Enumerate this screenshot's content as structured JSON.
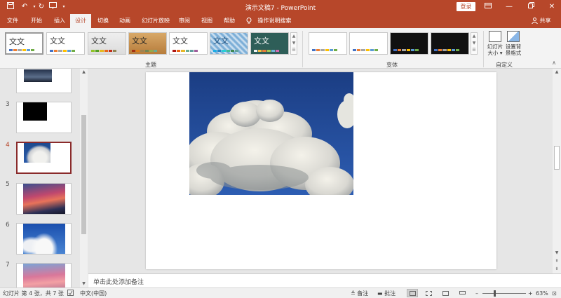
{
  "app": {
    "title": "演示文稿7  -  PowerPoint",
    "login_label": "登录",
    "quick_access": [
      "save-icon",
      "undo-icon",
      "redo-icon",
      "start-presentation-icon"
    ],
    "window_controls": [
      "ribbon-display-options-icon",
      "minimize-icon",
      "maximize-icon",
      "close-icon"
    ]
  },
  "ribbon": {
    "tabs": [
      {
        "label": "文件"
      },
      {
        "label": "开始"
      },
      {
        "label": "插入"
      },
      {
        "label": "设计"
      },
      {
        "label": "切换"
      },
      {
        "label": "动画"
      },
      {
        "label": "幻灯片放映"
      },
      {
        "label": "审阅"
      },
      {
        "label": "视图"
      },
      {
        "label": "帮助"
      }
    ],
    "active_tab": "设计",
    "tell_me": "操作说明搜索",
    "share_label": "共享",
    "themes_group": {
      "label": "主题",
      "items": [
        {
          "text": "文文",
          "style": "office"
        },
        {
          "text": "文文",
          "style": "office-theme"
        },
        {
          "text": "文文",
          "style": "facet"
        },
        {
          "text": "文文",
          "style": "wood"
        },
        {
          "text": "文文",
          "style": "ion-light"
        },
        {
          "text": "文文",
          "style": "pattern"
        },
        {
          "text": "文文",
          "style": "chalkboard"
        }
      ]
    },
    "variants_group": {
      "label": "变体",
      "count": 4
    },
    "customize_group": {
      "label": "自定义",
      "buttons": [
        {
          "label_line1": "幻灯片",
          "label_line2": "大小 ▾"
        },
        {
          "label_line1": "设置背",
          "label_line2": "景格式"
        }
      ]
    }
  },
  "slides_panel": {
    "slides": [
      {
        "number": "",
        "image": "night-city-cloud"
      },
      {
        "number": "3",
        "image": "black-thumbnail"
      },
      {
        "number": "4",
        "image": "cloud-blue-sky",
        "active": true
      },
      {
        "number": "5",
        "image": "red-sunset-clouds"
      },
      {
        "number": "6",
        "image": "white-clouds-blue-sky"
      },
      {
        "number": "7",
        "image": "pink-sunset-clouds"
      }
    ]
  },
  "main": {
    "picture": "cumulus-cloud-blue-sky"
  },
  "notes": {
    "placeholder": "单击此处添加备注"
  },
  "statusbar": {
    "slide_info": "幻灯片 第 4 张，共 7 张",
    "language": "中文(中国)",
    "notes_label": "备注",
    "comments_label": "批注",
    "zoom": "63%"
  },
  "colors": {
    "accent": "#b7472a",
    "ribbon_bg": "#f3f3f3",
    "workspace_bg": "#e6e6e6"
  }
}
